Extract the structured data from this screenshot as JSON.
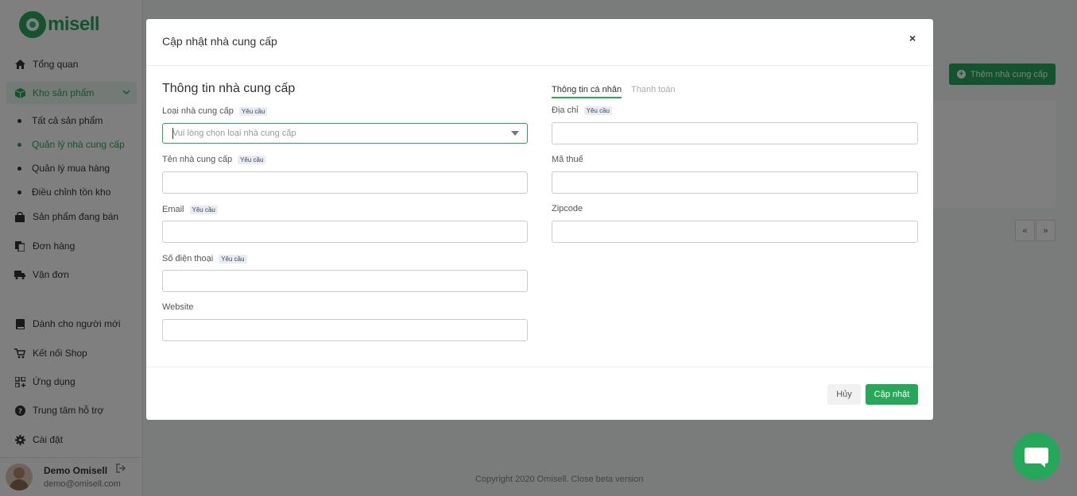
{
  "brand": {
    "name": "misell",
    "accent": "#27a75a"
  },
  "sidebar": {
    "items": [
      {
        "label": "Tổng quan",
        "icon": "home-icon"
      },
      {
        "label": "Kho sản phẩm",
        "icon": "box-icon"
      },
      {
        "label": "Sản phẩm đang bán",
        "icon": "bag-icon"
      },
      {
        "label": "Đơn hàng",
        "icon": "orders-icon"
      },
      {
        "label": "Vận đơn",
        "icon": "truck-icon"
      },
      {
        "label": "Dành cho người mới",
        "icon": "book-icon"
      },
      {
        "label": "Kết nối Shop",
        "icon": "cart-icon"
      },
      {
        "label": "Ứng dụng",
        "icon": "apps-icon"
      },
      {
        "label": "Trung tâm hỗ trợ",
        "icon": "help-icon"
      },
      {
        "label": "Cài đặt",
        "icon": "gear-icon"
      }
    ],
    "sub_items": [
      {
        "label": "Tất cả sản phẩm"
      },
      {
        "label": "Quản lý nhà cung cấp"
      },
      {
        "label": "Quản lý mua hàng"
      },
      {
        "label": "Điều chỉnh tồn kho"
      }
    ],
    "user": {
      "name": "Demo Omisell",
      "email": "demo@omisell.com"
    }
  },
  "main": {
    "add_button": "Thêm nhà cung cấp",
    "pager": {
      "prev": "«",
      "next": "»"
    },
    "copyright": "Copyright 2020 Omisell. Close beta version"
  },
  "modal": {
    "title": "Cập nhật nhà cung cấp",
    "close": "×",
    "section_title": "Thông tin nhà cung cấp",
    "required_tag": "Yêu cầu",
    "left_fields": {
      "type": {
        "label": "Loại nhà cung cấp",
        "placeholder": "Vui lòng chọn loại nhà cung cấp"
      },
      "name": {
        "label": "Tên nhà cung cấp",
        "value": ""
      },
      "email": {
        "label": "Email",
        "value": ""
      },
      "phone": {
        "label": "Số điện thoại",
        "value": ""
      },
      "website": {
        "label": "Website",
        "value": ""
      }
    },
    "tabs": [
      {
        "label": "Thông tin cá nhân"
      },
      {
        "label": "Thanh toán"
      }
    ],
    "right_fields": {
      "address": {
        "label": "Địa chỉ",
        "value": ""
      },
      "tax": {
        "label": "Mã thuế",
        "value": ""
      },
      "zipcode": {
        "label": "Zipcode",
        "value": ""
      }
    },
    "cancel": "Hủy",
    "save": "Cập nhật"
  }
}
